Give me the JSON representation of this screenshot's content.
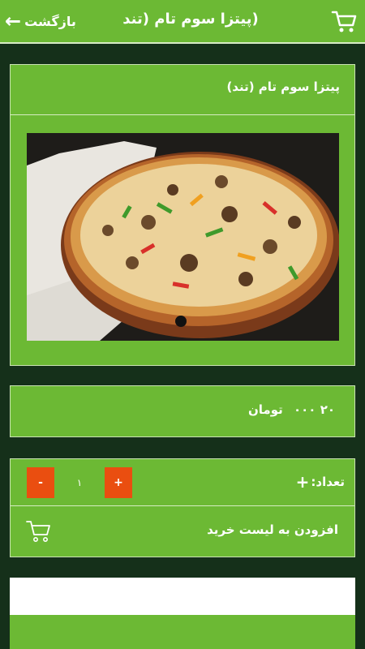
{
  "header": {
    "back_label": "بازگشت",
    "title": "(پیتزا سوم تام (تند",
    "cart_icon": "cart-icon",
    "back_icon": "arrow-left-icon"
  },
  "product": {
    "name": "پیتزا سوم تام (تند)",
    "image": "pizza-photo"
  },
  "price": {
    "amount": "۲۰ ۰۰۰",
    "currency": "تومان"
  },
  "quantity": {
    "label": "تعداد:",
    "value": "۱",
    "minus_label": "-",
    "plus_label": "+"
  },
  "cart_action": {
    "label": "افزودن به لیست خرید"
  },
  "colors": {
    "primary": "#6cb934",
    "background": "#15301a",
    "button": "#ea4e10"
  }
}
